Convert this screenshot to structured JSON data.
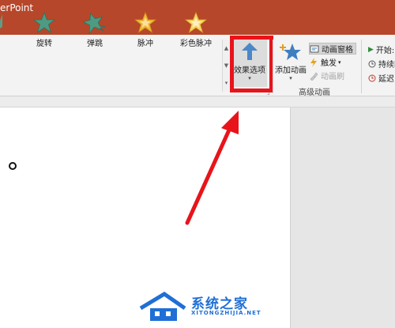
{
  "app": {
    "title": "erPoint"
  },
  "colors": {
    "title_bar": "#b7472a",
    "highlight": "#e8141a",
    "watermark": "#1f6fd6"
  },
  "gallery": {
    "items": [
      {
        "label": "",
        "icon": "star-partial-icon"
      },
      {
        "label": "旋转",
        "icon": "spin-star-icon"
      },
      {
        "label": "弹跳",
        "icon": "bounce-star-icon"
      },
      {
        "label": "脉冲",
        "icon": "pulse-star-icon"
      },
      {
        "label": "彩色脉冲",
        "icon": "color-pulse-star-icon"
      }
    ]
  },
  "effect_options": {
    "label": "效果选项",
    "icon": "up-arrow-icon"
  },
  "advanced_animation": {
    "group_label": "高级动画",
    "add_animation": "添加动画",
    "animation_pane": "动画窗格",
    "trigger": "触发",
    "animation_painter": "动画刷"
  },
  "timing": {
    "start": "开始:",
    "duration": "持续时",
    "delay": "延迟:"
  },
  "watermark": {
    "main": "系统之家",
    "sub": "XITONGZHIJIA.NET"
  }
}
